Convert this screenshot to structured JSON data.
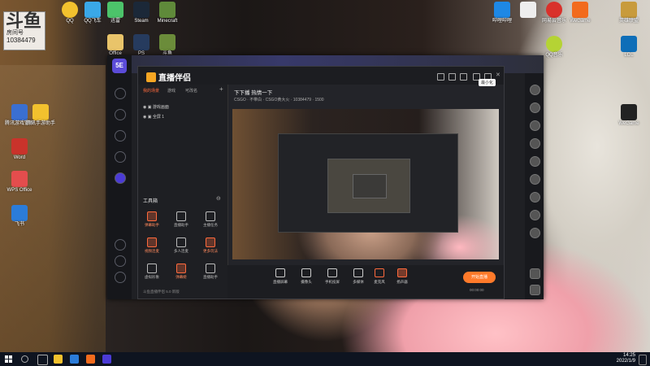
{
  "desktop": {
    "sticky_note": {
      "logo": "斗鱼",
      "line1": "房间号",
      "line2": "10384479"
    },
    "icons_left": [
      "腾讯游戏管家",
      "Word",
      "WPS Office",
      "腾讯手游助手",
      "飞书"
    ],
    "icons_top": [
      "QQ",
      "QQ飞车",
      "迅雷",
      "Steam",
      "Minecraft",
      "PS",
      "Office",
      "斗鱼"
    ],
    "icons_right": [
      "哔哩哔哩",
      "网易云音乐",
      "WeGame",
      "英雄联盟",
      "LOL",
      "QQ音乐",
      "WeGame"
    ]
  },
  "window": {
    "rail": {
      "logo": "5E"
    },
    "top_tab": "热门",
    "title_tooltip": "最小化",
    "app": {
      "brand": "直播伴侣",
      "tabs": [
        "我的场景",
        "游戏",
        "可改名"
      ],
      "scenes": [
        "游戏画面",
        "全屏 1"
      ],
      "tools_title": "工具箱",
      "tools": [
        {
          "label": "弹幕助手",
          "hot": true
        },
        {
          "label": "直播助手",
          "hot": false
        },
        {
          "label": "主播任务",
          "hot": false
        },
        {
          "label": "视频连麦",
          "hot": true
        },
        {
          "label": "多人连麦",
          "hot": false
        },
        {
          "label": "更多玩法",
          "hot": true
        },
        {
          "label": "虚拟形象",
          "hot": false
        },
        {
          "label": "弹幕姬",
          "hot": true
        },
        {
          "label": "直播助手",
          "hot": false
        }
      ],
      "stream_title": "下下播  热情一下",
      "stream_sub": "CSGO · 不带白 · CSGO黄大火 · 10384479 · 1500",
      "bottom_buttons": [
        "直播屏幕",
        "摄像头",
        "手机投屏",
        "多媒体",
        "麦克风",
        "扬声器"
      ],
      "start_label": "开始直播",
      "timer": "00:00:00",
      "status_line": "斗鱼直播伴侣 5.0 新版"
    }
  },
  "taskbar": {
    "time": "14:25",
    "date": "2022/1/9"
  }
}
